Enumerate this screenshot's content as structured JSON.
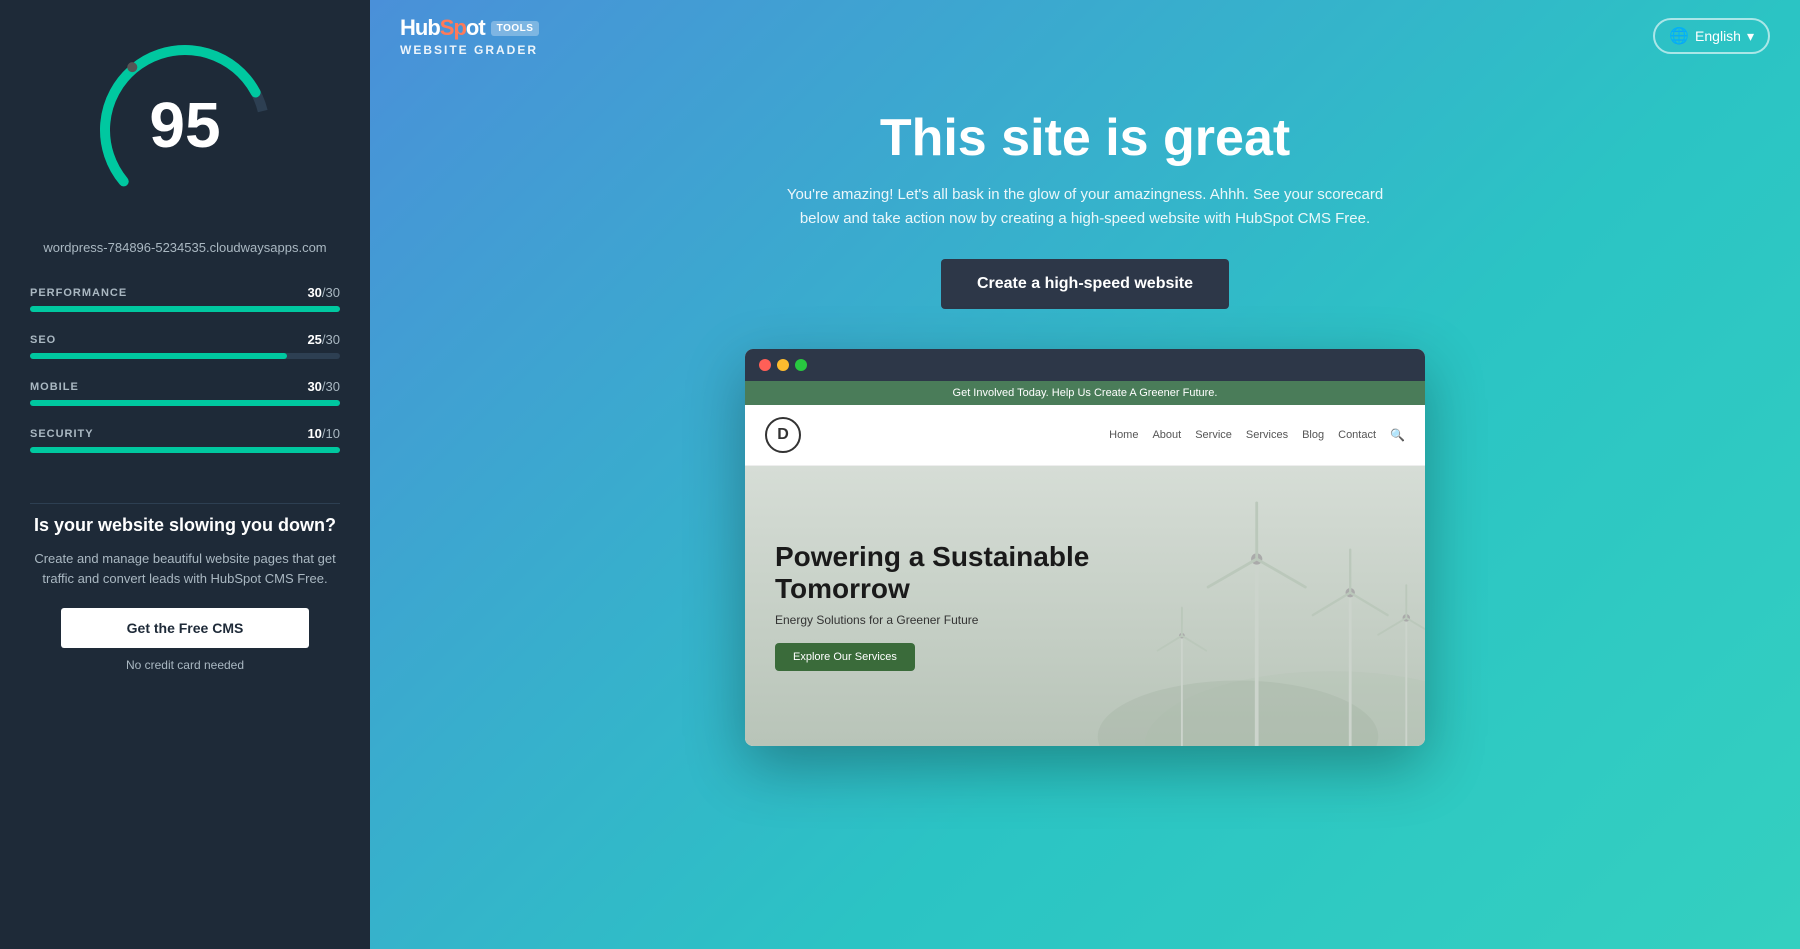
{
  "sidebar": {
    "score": "95",
    "site_url": "wordpress-784896-5234535.cloudwaysapps.com",
    "metrics": [
      {
        "label": "PERFORMANCE",
        "score": "30",
        "max": "30",
        "percent": 100
      },
      {
        "label": "SEO",
        "score": "25",
        "max": "30",
        "percent": 83
      },
      {
        "label": "MOBILE",
        "score": "30",
        "max": "30",
        "percent": 100
      },
      {
        "label": "SECURITY",
        "score": "10",
        "max": "10",
        "percent": 100
      }
    ],
    "cta_heading": "Is your website slowing you down?",
    "cta_text": "Create and manage beautiful website pages that get traffic and convert leads with HubSpot CMS Free.",
    "cta_button_label": "Get the Free CMS",
    "cta_note": "No credit card needed"
  },
  "header": {
    "logo_hub": "Hub",
    "logo_spot": "Sp",
    "logo_ot": "ot",
    "tools_badge": "TOOLS",
    "website_grader": "WEBSITE GRADER",
    "lang_label": "English"
  },
  "hero": {
    "title": "This site is great",
    "subtitle": "You're amazing! Let's all bask in the glow of your amazingness. Ahhh. See your scorecard below and take action now by creating a high-speed website with HubSpot CMS Free.",
    "cta_button": "Create a high-speed website"
  },
  "browser_mockup": {
    "banner_text": "Get Involved Today. Help Us Create A Greener Future.",
    "logo_letter": "D",
    "nav_items": [
      "Home",
      "About",
      "Service",
      "Services",
      "Blog",
      "Contact"
    ],
    "hero_title": "Powering a Sustainable Tomorrow",
    "hero_subtitle": "Energy Solutions for a Greener Future",
    "hero_btn": "Explore Our Services"
  },
  "colors": {
    "teal": "#00c8a0",
    "sidebar_bg": "#1e2a38",
    "main_bg_start": "#4a90d9",
    "main_bg_end": "#2bc4c4"
  }
}
